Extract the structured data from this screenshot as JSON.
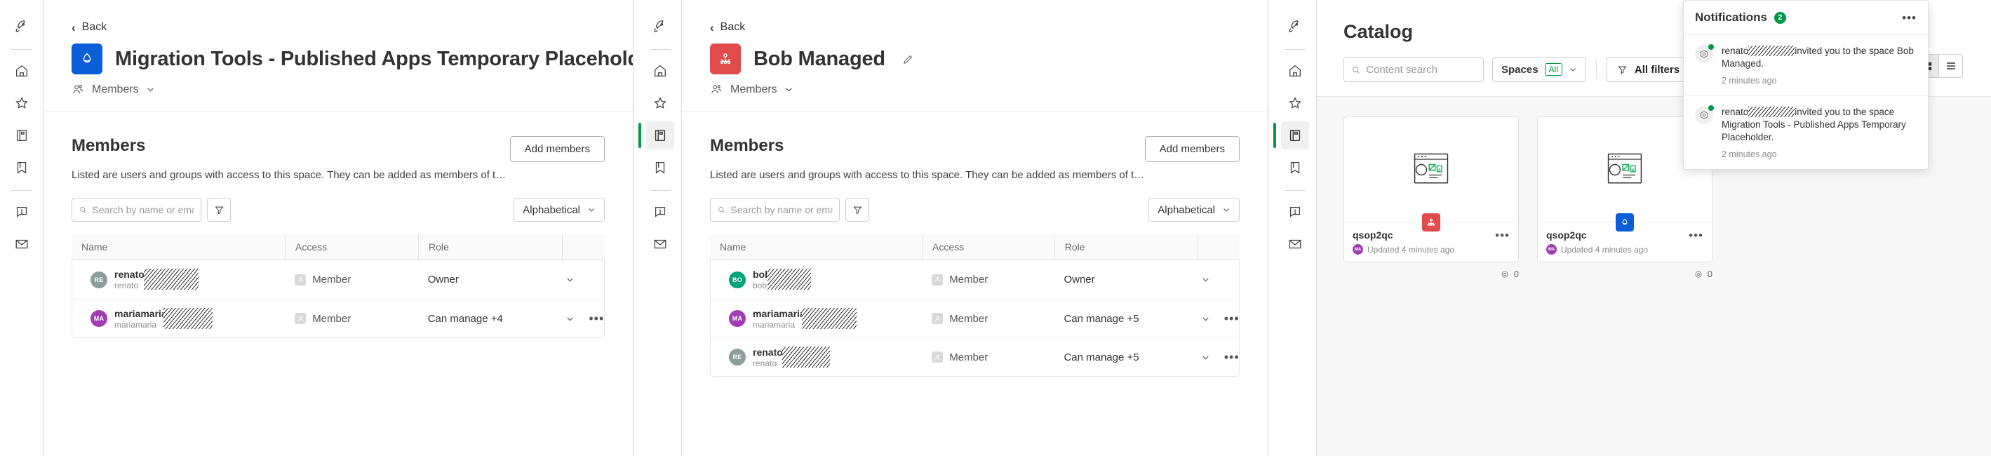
{
  "sidebar": {
    "items": [
      {
        "id": "rocket",
        "icon": "rocket-icon"
      },
      {
        "id": "home",
        "icon": "home-icon"
      },
      {
        "id": "favorites",
        "icon": "star-icon"
      },
      {
        "id": "catalog",
        "icon": "catalog-book-icon"
      },
      {
        "id": "collections",
        "icon": "bookmark-icon"
      },
      {
        "id": "alerts",
        "icon": "alert-chat-icon"
      },
      {
        "id": "mail",
        "icon": "mail-icon"
      }
    ]
  },
  "panel1": {
    "back_label": "Back",
    "title": "Migration Tools - Published Apps Temporary Placeholder",
    "avatar_color": "#0a5ed7",
    "avatar_icon": "space-shared-icon",
    "subnav_label": "Members",
    "section_title": "Members",
    "section_desc": "Listed are users and groups with access to this space. They can be added as members of the space or given access to spe...",
    "add_members_label": "Add members",
    "search_placeholder": "Search by name or email",
    "search_value": "",
    "sort_label": "Alphabetical",
    "columns": [
      "Name",
      "Access",
      "Role",
      ""
    ],
    "rows": [
      {
        "initials": "RE",
        "avatar_color": "#8a9e9b",
        "name": "renato",
        "name_redact_w": 78,
        "sub": "renato",
        "sub_redact_w": 70,
        "access": "Member",
        "role": "Owner",
        "has_dots": false
      },
      {
        "initials": "MA",
        "avatar_color": "#a23cb5",
        "name": "mariamaria",
        "name_redact_w": 70,
        "sub": "mariamaria",
        "sub_redact_w": 65,
        "access": "Member",
        "role": "Can manage +4",
        "has_dots": true
      }
    ]
  },
  "panel2": {
    "back_label": "Back",
    "title": "Bob Managed",
    "avatar_color": "#e24b4b",
    "avatar_icon": "managed-space-icon",
    "subnav_label": "Members",
    "section_title": "Members",
    "section_desc": "Listed are users and groups with access to this space. They can be added as members of the space or given access to specific content.",
    "add_members_label": "Add members",
    "search_placeholder": "Search by name or email",
    "search_value": "",
    "sort_label": "Alphabetical",
    "columns": [
      "Name",
      "Access",
      "Role",
      ""
    ],
    "rows": [
      {
        "initials": "BO",
        "avatar_color": "#00a37a",
        "name": "bob",
        "name_redact_w": 62,
        "sub": "bob",
        "sub_redact_w": 60,
        "access": "Member",
        "role": "Owner",
        "has_dots": false
      },
      {
        "initials": "MA",
        "avatar_color": "#a23cb5",
        "name": "mariamaria",
        "name_redact_w": 78,
        "sub": "mariamaria",
        "sub_redact_w": 70,
        "access": "Member",
        "role": "Can manage +5",
        "has_dots": true
      },
      {
        "initials": "RE",
        "avatar_color": "#8a9e9b",
        "name": "renato",
        "name_redact_w": 68,
        "sub": "renato",
        "sub_redact_w": 62,
        "access": "Member",
        "role": "Can manage +5",
        "has_dots": true
      }
    ]
  },
  "catalog": {
    "title": "Catalog",
    "search_placeholder": "Content search",
    "search_value": "",
    "spaces_label": "Spaces",
    "spaces_pill": "All",
    "all_filters_label": "All filters",
    "view_grid_icon": "grid-view-icon",
    "view_list_icon": "list-view-icon",
    "cards": [
      {
        "name": "qsop2qc",
        "meta": "Updated 4 minutes ago",
        "avatar_initials": "MA",
        "badge_color": "#e24b4b",
        "badge_icon": "managed-space-icon",
        "views": "0"
      },
      {
        "name": "qsop2qc",
        "meta": "Updated 4 minutes ago",
        "avatar_initials": "MA",
        "badge_color": "#0a5ed7",
        "badge_icon": "space-shared-icon",
        "views": "0"
      }
    ]
  },
  "notifications": {
    "title": "Notifications",
    "count": "2",
    "menu_icon": "more-options-icon",
    "items": [
      {
        "prefix": "renato",
        "suffix": "invited you to the space Bob Managed.",
        "time": "2 minutes ago",
        "redact_w": 66
      },
      {
        "prefix": "renato",
        "suffix": "invited you to the space Migration Tools - Published Apps Temporary Placeholder.",
        "time": "2 minutes ago",
        "redact_w": 66
      }
    ]
  },
  "colors": {
    "accent_green": "#009845",
    "accent_blue": "#0a5ed7",
    "accent_red": "#e24b4b",
    "border": "#e0e0e0"
  }
}
